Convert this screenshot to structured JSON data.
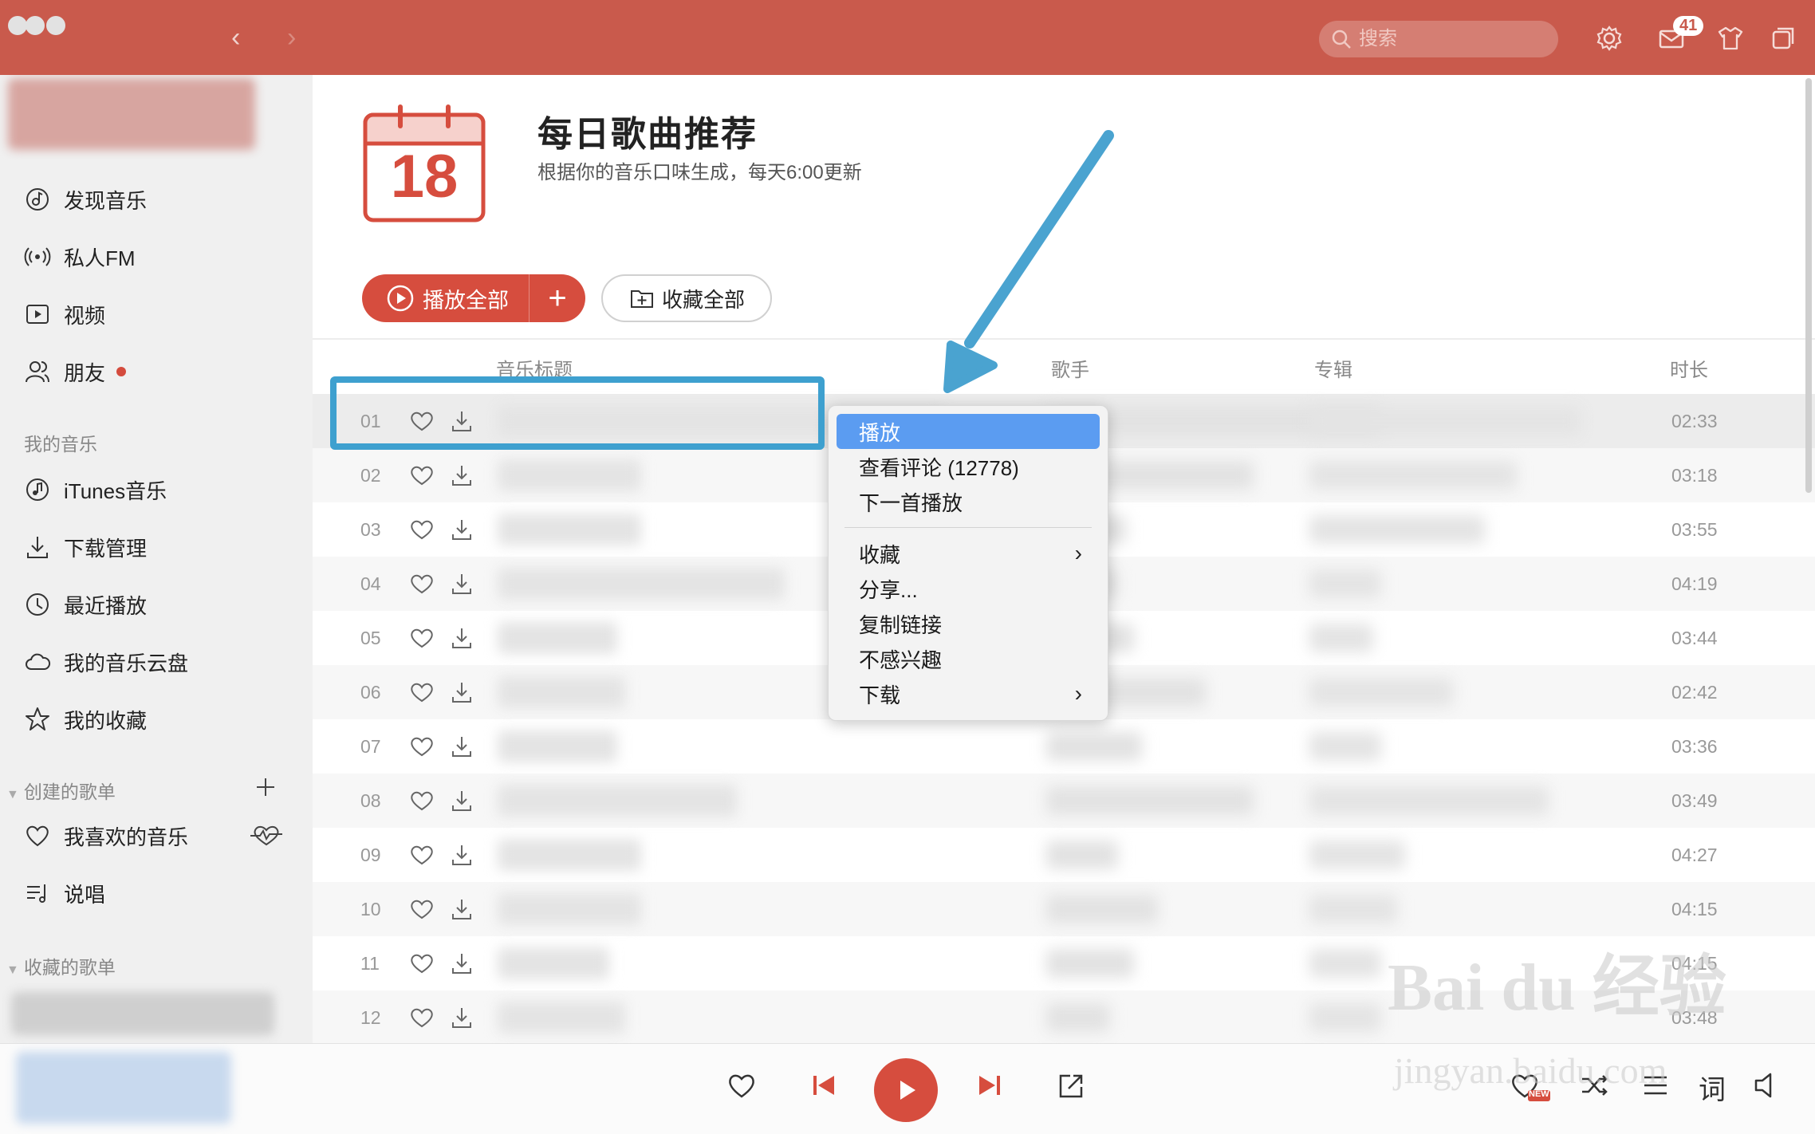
{
  "window": {
    "search_placeholder": "搜索",
    "message_count": "41"
  },
  "sidebar": {
    "nav": [
      {
        "label": "发现音乐",
        "icon": "music-note-icon"
      },
      {
        "label": "私人FM",
        "icon": "radio-icon"
      },
      {
        "label": "视频",
        "icon": "video-icon"
      },
      {
        "label": "朋友",
        "icon": "friends-icon"
      }
    ],
    "my_music_title": "我的音乐",
    "my_music": [
      {
        "label": "iTunes音乐"
      },
      {
        "label": "下载管理"
      },
      {
        "label": "最近播放"
      },
      {
        "label": "我的音乐云盘"
      },
      {
        "label": "我的收藏"
      }
    ],
    "created_title": "创建的歌单",
    "created": [
      {
        "label": "我喜欢的音乐"
      },
      {
        "label": "说唱"
      }
    ],
    "collected_title": "收藏的歌单"
  },
  "header": {
    "calendar_day": "18",
    "title": "每日歌曲推荐",
    "subtitle": "根据你的音乐口味生成，每天6:00更新",
    "play_all_label": "播放全部",
    "add_label": "+",
    "collect_all_label": "收藏全部"
  },
  "table": {
    "columns": [
      "音乐标题",
      "歌手",
      "专辑",
      "时长"
    ],
    "rows": [
      {
        "num": "01",
        "duration": "02:33"
      },
      {
        "num": "02",
        "duration": "03:18"
      },
      {
        "num": "03",
        "duration": "03:55"
      },
      {
        "num": "04",
        "duration": "04:19"
      },
      {
        "num": "05",
        "duration": "03:44"
      },
      {
        "num": "06",
        "duration": "02:42"
      },
      {
        "num": "07",
        "duration": "03:36"
      },
      {
        "num": "08",
        "duration": "03:49"
      },
      {
        "num": "09",
        "duration": "04:27"
      },
      {
        "num": "10",
        "duration": "04:15"
      },
      {
        "num": "11",
        "duration": "04:15"
      },
      {
        "num": "12",
        "duration": "03:48"
      }
    ]
  },
  "context_menu": {
    "items": [
      {
        "label": "播放",
        "active": true
      },
      {
        "label": "查看评论 (12778)"
      },
      {
        "label": "下一首播放"
      },
      {
        "label": "收藏",
        "submenu": true
      },
      {
        "label": "分享..."
      },
      {
        "label": "复制链接"
      },
      {
        "label": "不感兴趣"
      },
      {
        "label": "下载",
        "submenu": true
      }
    ]
  },
  "player": {
    "lyrics_label": "词",
    "new_badge": "NEW"
  },
  "watermark": {
    "brand": "Bai du 经验",
    "url": "jingyan.baidu.com"
  },
  "colors": {
    "brand_red": "#c95a4c",
    "play_red": "#d64d3e",
    "menu_active": "#5b9cf1",
    "annotation_blue": "#3ea0cf"
  }
}
